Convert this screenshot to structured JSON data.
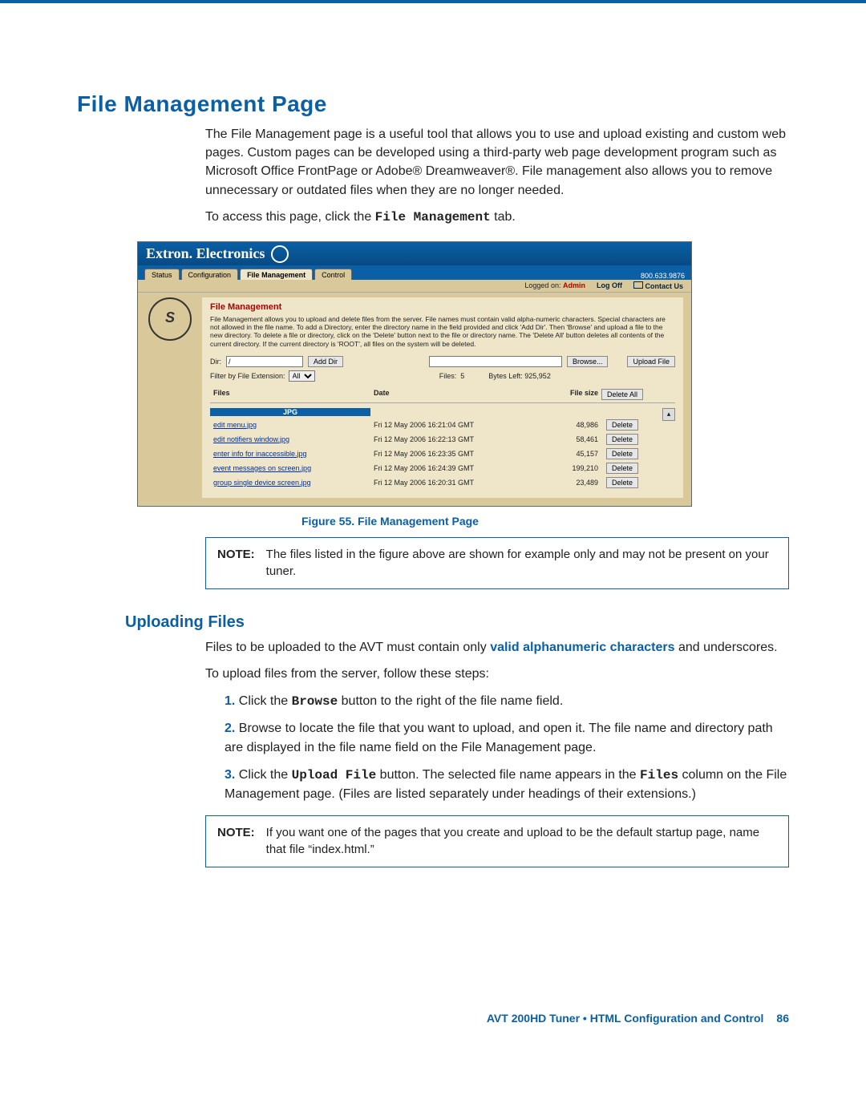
{
  "section_title": "File Management Page",
  "intro_text": "The File Management page is a useful tool that allows you to use and upload existing and custom web pages. Custom pages can be developed using a third-party web page development program such as Microsoft Office FrontPage or Adobe® Dreamweaver®. File management also allows you to remove unnecessary or outdated files when they are no longer needed.",
  "access_text_pre": "To access this page, click the ",
  "access_text_mono": "File Management",
  "access_text_post": " tab.",
  "shot": {
    "brand": "Extron. Electronics",
    "tabs": {
      "status": "Status",
      "config": "Configuration",
      "fm": "File Management",
      "control": "Control"
    },
    "phone": "800.633.9876",
    "logged_on_label": "Logged on:",
    "logged_on_user": "Admin",
    "logoff": "Log Off",
    "contact": "Contact Us",
    "fm_title": "File Management",
    "fm_desc": "File Management allows you to upload and delete files from the server. File names must contain valid alpha-numeric characters. Special characters are not allowed in the file name. To add a Directory, enter the directory name in the field provided and click 'Add Dir'. Then 'Browse' and upload a file to the new directory. To delete a file or directory, click on the 'Delete' button next to the file or directory name. The 'Delete All' button deletes all contents of the current directory. If the current directory is 'ROOT', all files on the system will be deleted.",
    "dir_label": "Dir:",
    "dir_value": "/",
    "add_dir": "Add Dir",
    "browse": "Browse...",
    "upload": "Upload File",
    "filter_label": "Filter by File Extension:",
    "filter_value": "All",
    "files_label": "Files:",
    "files_count": "5",
    "bytes_label": "Bytes Left: 925,952",
    "col_files": "Files",
    "col_date": "Date",
    "col_size": "File size",
    "delete_all": "Delete All",
    "ext_heading": "JPG",
    "delete_btn": "Delete",
    "rows": [
      {
        "name": "edit menu.jpg",
        "date": "Fri 12 May 2006 16:21:04 GMT",
        "size": "48,986"
      },
      {
        "name": "edit notifiers window.jpg",
        "date": "Fri 12 May 2006 16:22:13 GMT",
        "size": "58,461"
      },
      {
        "name": "enter info for inaccessible.jpg",
        "date": "Fri 12 May 2006 16:23:35 GMT",
        "size": "45,157"
      },
      {
        "name": "event messages on screen.jpg",
        "date": "Fri 12 May 2006 16:24:39 GMT",
        "size": "199,210"
      },
      {
        "name": "group single device screen.jpg",
        "date": "Fri 12 May 2006 16:20:31 GMT",
        "size": "23,489"
      }
    ]
  },
  "figure_caption": "Figure 55. File Management Page",
  "note1_label": "NOTE:",
  "note1_text": "The files listed in the figure above are shown for example only and may not be present on your tuner.",
  "subsection_title": "Uploading Files",
  "upload_intro_pre": "Files to be uploaded to the AVT must contain only ",
  "upload_intro_bold": "valid alphanumeric characters",
  "upload_intro_post": " and underscores.",
  "upload_follow": "To upload files from the server, follow these steps:",
  "step1_pre": "Click the ",
  "step1_mono": "Browse",
  "step1_post": " button to the right of the file name field.",
  "step2": "Browse to locate the file that you want to upload, and open it. The file name and directory path are displayed in the file name field on the File Management page.",
  "step3_pre": "Click the ",
  "step3_mono1": "Upload File",
  "step3_mid": " button. The selected file name appears in the ",
  "step3_mono2": "Files",
  "step3_post": " column on the File Management page. (Files are listed separately under headings of their extensions.)",
  "note2_label": "NOTE:",
  "note2_text": "If you want one of the pages that you create and upload to be the default startup page, name that file “index.html.”",
  "footer_text": "AVT 200HD Tuner • HTML Configuration and Control",
  "footer_page": "86"
}
